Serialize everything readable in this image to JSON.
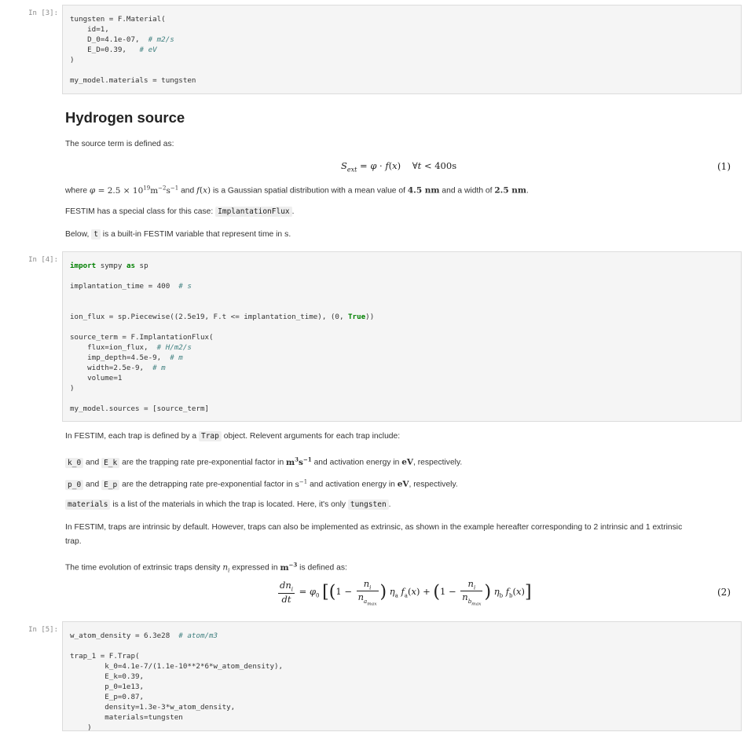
{
  "cells": {
    "cell3": {
      "prompt": "In [3]:",
      "l1": "tungsten = F.Material(",
      "l2": "    id=1,",
      "l3a": "    D_0=4.1e-07,",
      "l3b": "  # m2/s",
      "l4a": "    E_D=0.39,",
      "l4b": "   # eV",
      "l5": ")",
      "l6": "my_model.materials = tungsten"
    },
    "cell4": {
      "prompt": "In [4]:",
      "l1a": "import",
      "l1b": " sympy ",
      "l1c": "as",
      "l1d": " sp",
      "l2a": "implantation_time = 400",
      "l2b": "  # s",
      "l3": "ion_flux = sp.Piecewise((2.5e19, F.t <= implantation_time), (0, ",
      "l3t": "True",
      "l3e": "))",
      "l4": "source_term = F.ImplantationFlux(",
      "l5a": "    flux=ion_flux,",
      "l5b": "  # H/m2/s",
      "l6a": "    imp_depth=4.5e-9,",
      "l6b": "  # m",
      "l7a": "    width=2.5e-9,",
      "l7b": "  # m",
      "l8": "    volume=1",
      "l9": ")",
      "l10": "my_model.sources = [source_term]"
    },
    "cell5": {
      "prompt": "In [5]:",
      "l1a": "w_atom_density = 6.3e28",
      "l1b": "  # atom/m3",
      "l2": "trap_1 = F.Trap(",
      "l3": "        k_0=4.1e-7/(1.1e-10**2*6*w_atom_density),",
      "l4": "        E_k=0.39,",
      "l5": "        p_0=1e13,",
      "l6": "        E_p=0.87,",
      "l7": "        density=1.3e-3*w_atom_density,",
      "l8": "        materials=tungsten",
      "l9": "    )"
    }
  },
  "markdown": {
    "heading": "Hydrogen source",
    "p1": "The source term is defined as:",
    "eq1_num": "(1)",
    "p2_a": "where ",
    "p2_b": " is a Gaussian spatial distribution with a mean value of ",
    "p2_c": " and a width of ",
    "p2_mean": "4.5 nm",
    "p2_width": "2.5 nm",
    "p2_and": " and ",
    "p3_a": "FESTIM has a special class for this case: ",
    "p3_code": "ImplantationFlux",
    "p3_b": ".",
    "p4_a": "Below, ",
    "p4_code": "t",
    "p4_b": " is a built-in FESTIM variable that represent time in ",
    "p4_unit": "s",
    "p4_end": ".",
    "t1_a": "In FESTIM, each trap is defined by a ",
    "t1_code": "Trap",
    "t1_b": " object. Relevent arguments for each trap include:",
    "t2_code1": "k_0",
    "t2_and": " and ",
    "t2_code2": "E_k",
    "t2_b": " are the trapping rate pre-exponential factor in ",
    "t2_c": " and activation energy in ",
    "t2_ev": "eV",
    "t2_d": ", respectively.",
    "t3_code1": "p_0",
    "t3_and": " and ",
    "t3_code2": "E_p",
    "t3_b": " are the detrapping rate pre-exponential factor in ",
    "t3_c": " and activation energy in ",
    "t3_ev": "eV",
    "t3_d": ", respectively.",
    "t4_code1": "materials",
    "t4_b": " is a list of the materials in which the trap is located. Here, it's only ",
    "t4_code2": "tungsten",
    "t4_c": ".",
    "t5_l1": "In FESTIM, traps are intrinsic by default. However, traps can also be implemented as extrinsic, as shown in the example hereafter corresponding to 2 intrinsic and 1 extrinsic",
    "t5_l2": "trap.",
    "t6_a": "The time evolution of extrinsic traps density ",
    "t6_b": " expressed in ",
    "t6_c": " is defined as:",
    "eq2_num": "(2)"
  }
}
